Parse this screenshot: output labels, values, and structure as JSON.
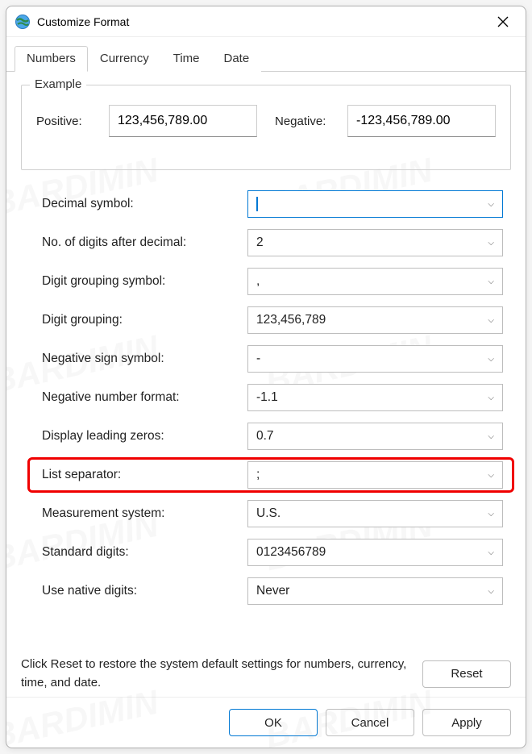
{
  "window": {
    "title": "Customize Format"
  },
  "tabs": {
    "numbers": "Numbers",
    "currency": "Currency",
    "time": "Time",
    "date": "Date"
  },
  "example": {
    "group_label": "Example",
    "positive_label": "Positive:",
    "positive_value": "123,456,789.00",
    "negative_label": "Negative:",
    "negative_value": "-123,456,789.00"
  },
  "fields": {
    "decimal_symbol": {
      "label": "Decimal symbol:",
      "value": ""
    },
    "digits_after_decimal": {
      "label": "No. of digits after decimal:",
      "value": "2"
    },
    "digit_grouping_symbol": {
      "label": "Digit grouping symbol:",
      "value": ","
    },
    "digit_grouping": {
      "label": "Digit grouping:",
      "value": "123,456,789"
    },
    "negative_sign_symbol": {
      "label": "Negative sign symbol:",
      "value": "-"
    },
    "negative_number_format": {
      "label": "Negative number format:",
      "value": "-1.1"
    },
    "display_leading_zeros": {
      "label": "Display leading zeros:",
      "value": "0.7"
    },
    "list_separator": {
      "label": "List separator:",
      "value": ";"
    },
    "measurement_system": {
      "label": "Measurement system:",
      "value": "U.S."
    },
    "standard_digits": {
      "label": "Standard digits:",
      "value": "0123456789"
    },
    "use_native_digits": {
      "label": "Use native digits:",
      "value": "Never"
    }
  },
  "reset": {
    "text": "Click Reset to restore the system default settings for numbers, currency, time, and date.",
    "button": "Reset"
  },
  "footer": {
    "ok": "OK",
    "cancel": "Cancel",
    "apply": "Apply"
  },
  "watermark": "BARDIMIN"
}
